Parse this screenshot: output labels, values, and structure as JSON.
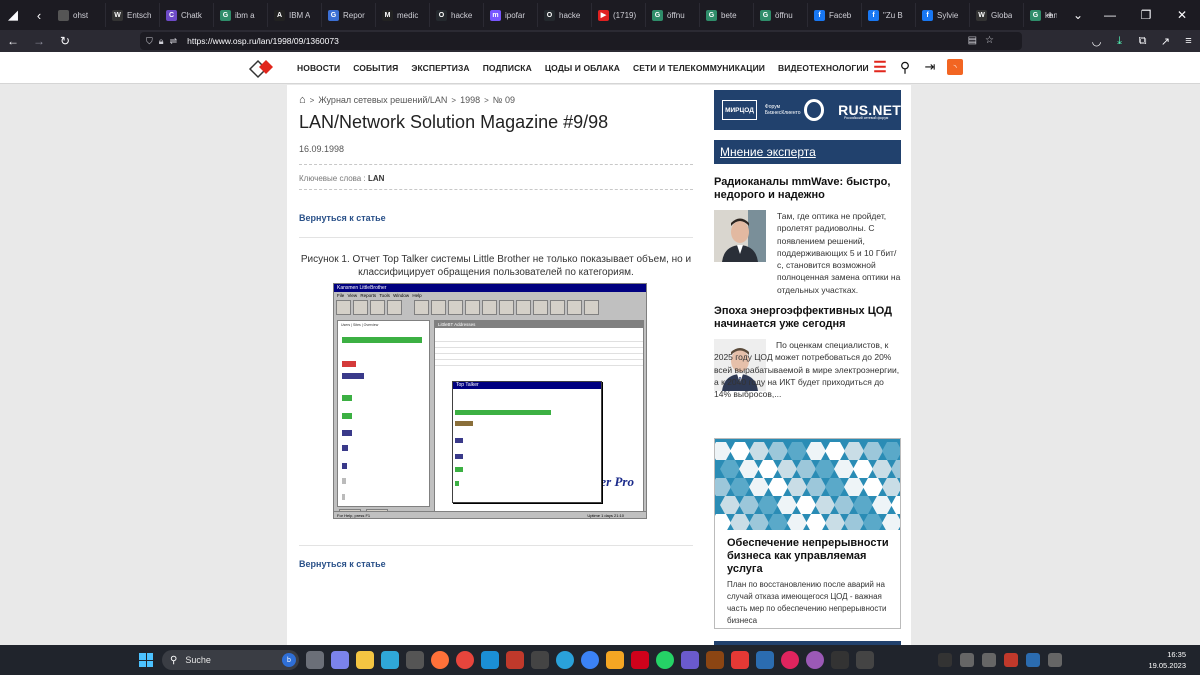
{
  "browser": {
    "tabs": [
      {
        "label": "ohst",
        "color": "#555"
      },
      {
        "label": "Entsch",
        "color": "#333",
        "glyph": "W"
      },
      {
        "label": "Chatk",
        "color": "#6d4ac7",
        "glyph": "C"
      },
      {
        "label": "ibm a",
        "color": "#2f8d6a",
        "glyph": "G"
      },
      {
        "label": "IBM A",
        "color": "#222",
        "glyph": "A"
      },
      {
        "label": "Repor",
        "color": "#3b6fd4",
        "glyph": "G"
      },
      {
        "label": "medic",
        "color": "#222",
        "glyph": "M"
      },
      {
        "label": "hacke",
        "color": "#24292e",
        "glyph": "O"
      },
      {
        "label": "ipofar",
        "color": "#7856ff",
        "glyph": "m"
      },
      {
        "label": "hacke",
        "color": "#24292e",
        "glyph": "O"
      },
      {
        "label": "(1719)",
        "color": "#e02020",
        "glyph": "▶"
      },
      {
        "label": "öffnu",
        "color": "#2f8d6a",
        "glyph": "G"
      },
      {
        "label": "bete",
        "color": "#2f8d6a",
        "glyph": "G"
      },
      {
        "label": "öffnu",
        "color": "#2f8d6a",
        "glyph": "G"
      },
      {
        "label": "Faceb",
        "color": "#1877f2",
        "glyph": "f"
      },
      {
        "label": "\"Zu B",
        "color": "#1877f2",
        "glyph": "f"
      },
      {
        "label": "Sylvie",
        "color": "#1877f2",
        "glyph": "f"
      },
      {
        "label": "Globa",
        "color": "#333",
        "glyph": "W"
      },
      {
        "label": "kansr",
        "color": "#2f8d6a",
        "glyph": "G"
      }
    ],
    "active_tab": {
      "label": "LAN",
      "color": "#d9231d"
    },
    "next_tab": {
      "label": "LAN/",
      "color": "#d9231d"
    },
    "url": "https://www.osp.ru/lan/1998/09/1360073"
  },
  "site": {
    "menu": [
      "НОВОСТИ",
      "СОБЫТИЯ",
      "ЭКСПЕРТИЗА",
      "ПОДПИСКА",
      "ЦОДЫ И ОБЛАКА",
      "СЕТИ И ТЕЛЕКОММУНИКАЦИИ",
      "ВИДЕОТЕХНОЛОГИИ"
    ],
    "accent": "#e1261c",
    "link_color": "#2a5189"
  },
  "article": {
    "breadcrumb": [
      "Журнал сетевых решений/LAN",
      "1998",
      "№ 09"
    ],
    "title": "LAN/Network Solution Magazine #9/98",
    "date": "16.09.1998",
    "keywords_label": "Ключевые слова :",
    "keyword": "LAN",
    "back_link": "Вернуться к статье",
    "caption": "Рисунок 1. Отчет Top Talker системы Little Brother не только показывает объем, но и классифицирует обращения пользователей по категориям.",
    "figure": {
      "window_title": "Kansmen LittleBrother",
      "menu": "File View Reports Tools Window Help",
      "tabs": [
        "Users",
        "Sites",
        "Overview"
      ],
      "addr_window": "LittleBT Addresses",
      "top_talker": "Top Talker",
      "brand": "er Pro",
      "configure": "Configure",
      "refresh": "Refresh",
      "status": "For Help, press F1",
      "uptime": "Uptime 1 days 21:10"
    }
  },
  "sidebar": {
    "banner": {
      "left": "МИРЦОД",
      "middle": "Форум БизнесКлиенто",
      "brand": "RUS.NET",
      "sub": "Российский сетевой форум"
    },
    "expert_header": "Мнение эксперта",
    "experts": [
      {
        "title": "Радиоканалы mmWave: быстро, недорого и надежно",
        "text": "Там, где оптика не пройдет, пролетят радиоволны. С появлением решений, поддерживающих 5 и 10 Гбит/с, становится возможной полноценная замена оптики на отдельных участках."
      },
      {
        "title": "Эпоха энергоэффективных ЦОД начинается уже сегодня",
        "text": "По оценкам специалистов, к 2025 году ЦОД может потребоваться до 20% всей вырабатываемой в мире электроэнергии, а к 2040 году на ИКТ будет приходиться до 14% выбросов,..."
      }
    ],
    "promo": {
      "title": "Обеспечение непрерывности бизнеса как управляемая услуга",
      "text": "План по восстановлению после аварий на случай отказа имеющегося ЦОД - важная часть мер по обеспечению непрерывности бизнеса"
    }
  },
  "taskbar": {
    "search_placeholder": "Suche",
    "time": "16:35",
    "date": "19.05.2023"
  }
}
